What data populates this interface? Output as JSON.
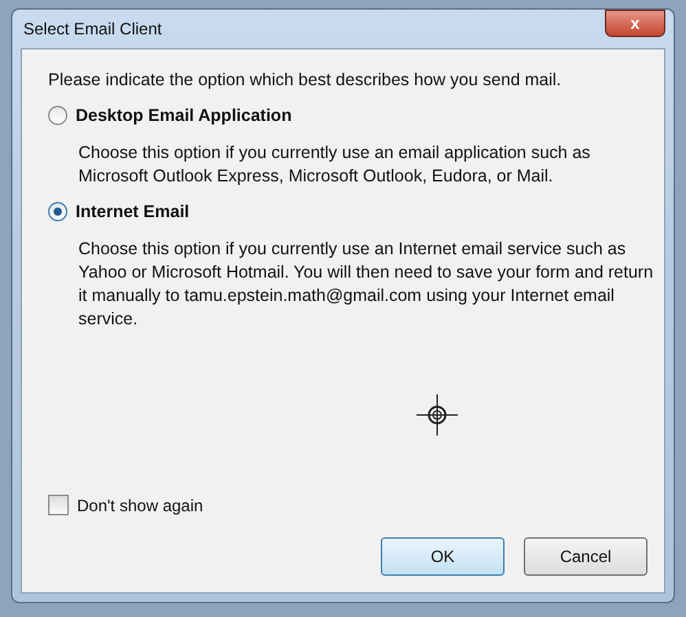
{
  "window": {
    "title": "Select Email Client",
    "close_label": "x"
  },
  "intro": "Please indicate the option which best describes how you send mail.",
  "options": [
    {
      "label": "Desktop Email Application",
      "selected": false,
      "description": "Choose this option if you currently use an email application such as Microsoft Outlook Express, Microsoft Outlook, Eudora, or Mail."
    },
    {
      "label": "Internet Email",
      "selected": true,
      "description": "Choose this option if you currently use an Internet email service such as Yahoo or Microsoft Hotmail. You will then need to save your form and return it manually to tamu.epstein.math@gmail.com using your Internet email service."
    }
  ],
  "dont_show_again": {
    "label": "Don't show again",
    "checked": false
  },
  "buttons": [
    {
      "label": "OK",
      "default": true
    },
    {
      "label": "Cancel",
      "default": false
    }
  ]
}
